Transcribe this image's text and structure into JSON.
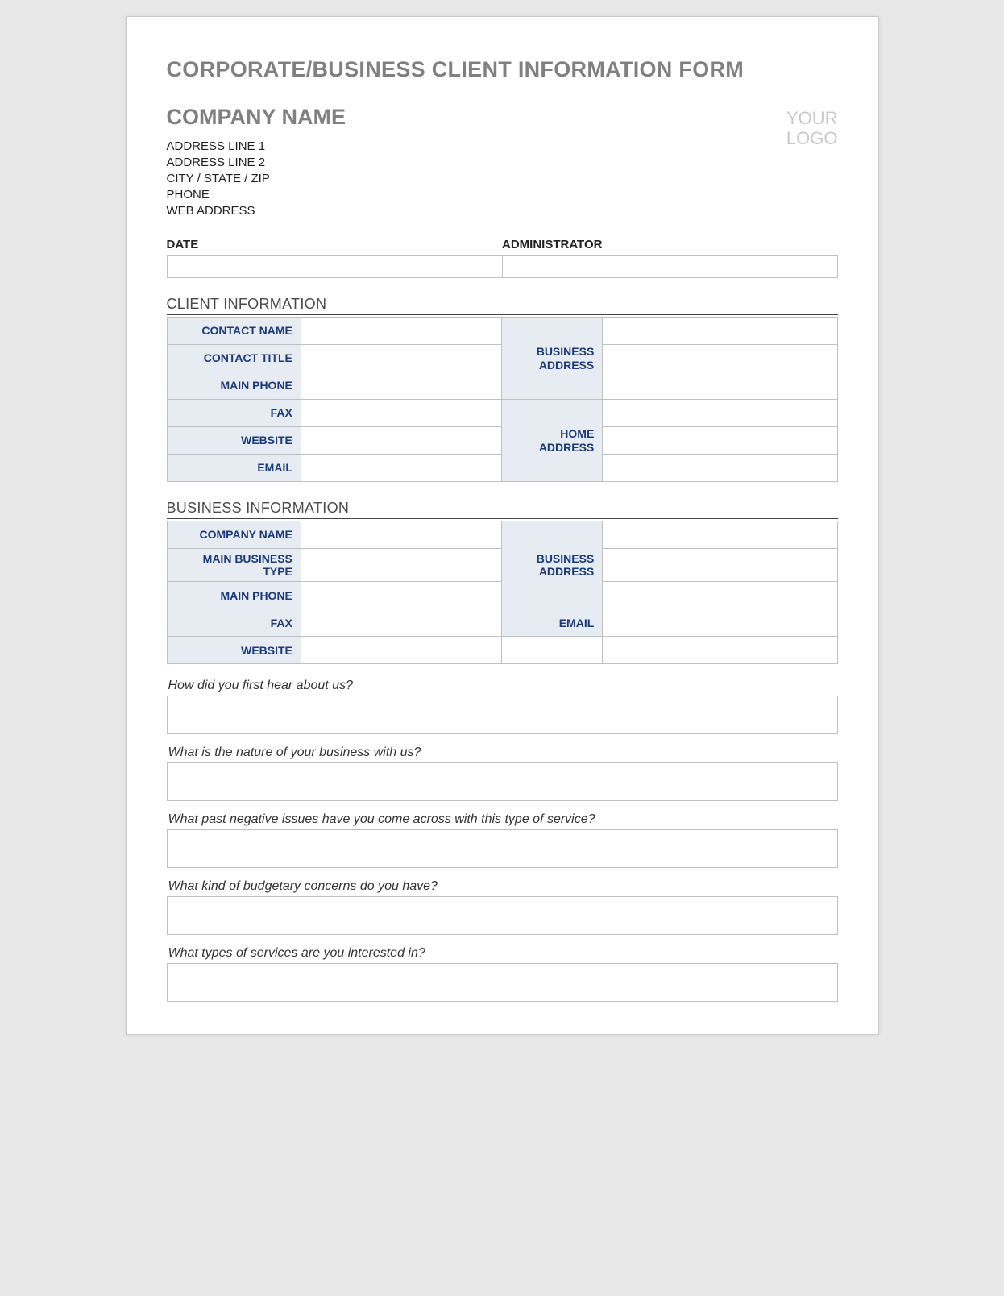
{
  "title": "CORPORATE/BUSINESS CLIENT INFORMATION FORM",
  "company": {
    "name": "COMPANY NAME",
    "addr1": "ADDRESS LINE 1",
    "addr2": "ADDRESS LINE 2",
    "csz": "CITY / STATE / ZIP",
    "phone": "PHONE",
    "web": "WEB ADDRESS"
  },
  "logo": {
    "line1": "YOUR",
    "line2": "LOGO"
  },
  "meta": {
    "date_label": "DATE",
    "admin_label": "ADMINISTRATOR"
  },
  "sections": {
    "client_title": "CLIENT INFORMATION",
    "business_title": "BUSINESS INFORMATION"
  },
  "client": {
    "contact_name": "CONTACT NAME",
    "contact_title": "CONTACT TITLE",
    "main_phone": "MAIN PHONE",
    "fax": "FAX",
    "website": "WEBSITE",
    "email": "EMAIL",
    "business_address": "BUSINESS ADDRESS",
    "home_address": "HOME ADDRESS"
  },
  "business": {
    "company_name": "COMPANY NAME",
    "main_business_type": "MAIN BUSINESS TYPE",
    "main_phone": "MAIN PHONE",
    "fax": "FAX",
    "website": "WEBSITE",
    "business_address": "BUSINESS ADDRESS",
    "email": "EMAIL"
  },
  "questions": {
    "q1": "How did you first hear about us?",
    "q2": "What is the nature of your business with us?",
    "q3": "What past negative issues have you come across with this type of service?",
    "q4": "What kind of budgetary concerns do you have?",
    "q5": "What types of services are you interested in?"
  }
}
